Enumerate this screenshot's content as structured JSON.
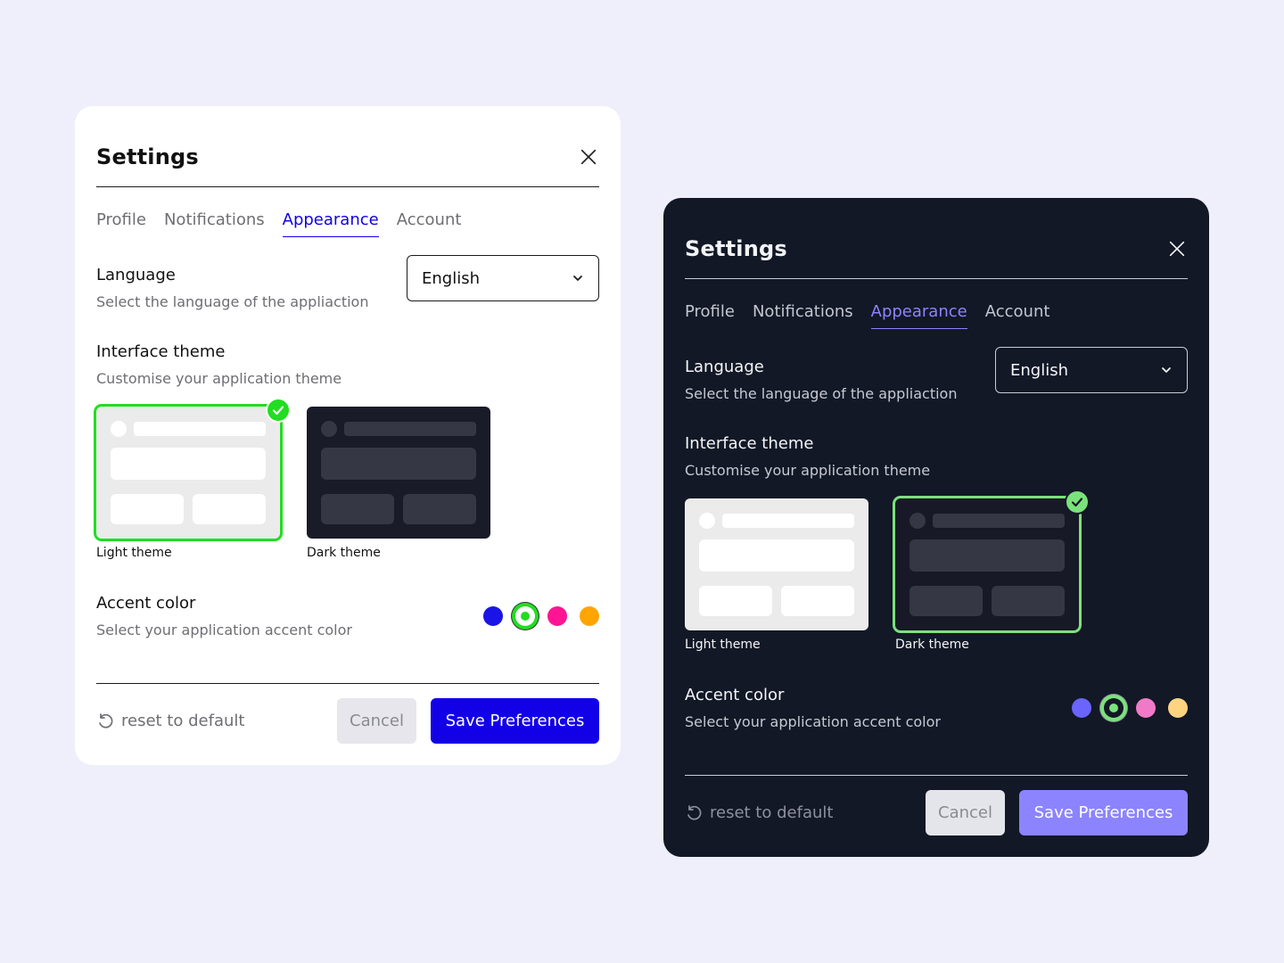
{
  "light": {
    "title": "Settings",
    "tabs": [
      {
        "label": "Profile"
      },
      {
        "label": "Notifications"
      },
      {
        "label": "Appearance"
      },
      {
        "label": "Account"
      }
    ],
    "active_tab": "Appearance",
    "language": {
      "title": "Language",
      "desc": "Select the language of the appliaction",
      "selected": "English"
    },
    "theme": {
      "title": "Interface theme",
      "desc": "Customise your application theme",
      "light_label": "Light theme",
      "dark_label": "Dark theme",
      "selected": "Light theme"
    },
    "accent": {
      "title": "Accent color",
      "desc": "Select your application accent color",
      "colors": [
        "#1a14e6",
        "#22dd22",
        "#ff1493",
        "#ffa500"
      ],
      "selected": "#22dd22"
    },
    "footer": {
      "reset_label": "reset to default",
      "cancel_label": "Cancel",
      "save_label": "Save Preferences"
    }
  },
  "dark": {
    "title": "Settings",
    "tabs": [
      {
        "label": "Profile"
      },
      {
        "label": "Notifications"
      },
      {
        "label": "Appearance"
      },
      {
        "label": "Account"
      }
    ],
    "active_tab": "Appearance",
    "language": {
      "title": "Language",
      "desc": "Select the language of the appliaction",
      "selected": "English"
    },
    "theme": {
      "title": "Interface theme",
      "desc": "Customise your application theme",
      "light_label": "Light theme",
      "dark_label": "Dark theme",
      "selected": "Dark theme"
    },
    "accent": {
      "title": "Accent color",
      "desc": "Select your application accent color",
      "colors": [
        "#6b64ff",
        "#7be27b",
        "#f07ac8",
        "#ffd480"
      ],
      "selected": "#7be27b"
    },
    "footer": {
      "reset_label": "reset to default",
      "cancel_label": "Cancel",
      "save_label": "Save Preferences"
    }
  }
}
